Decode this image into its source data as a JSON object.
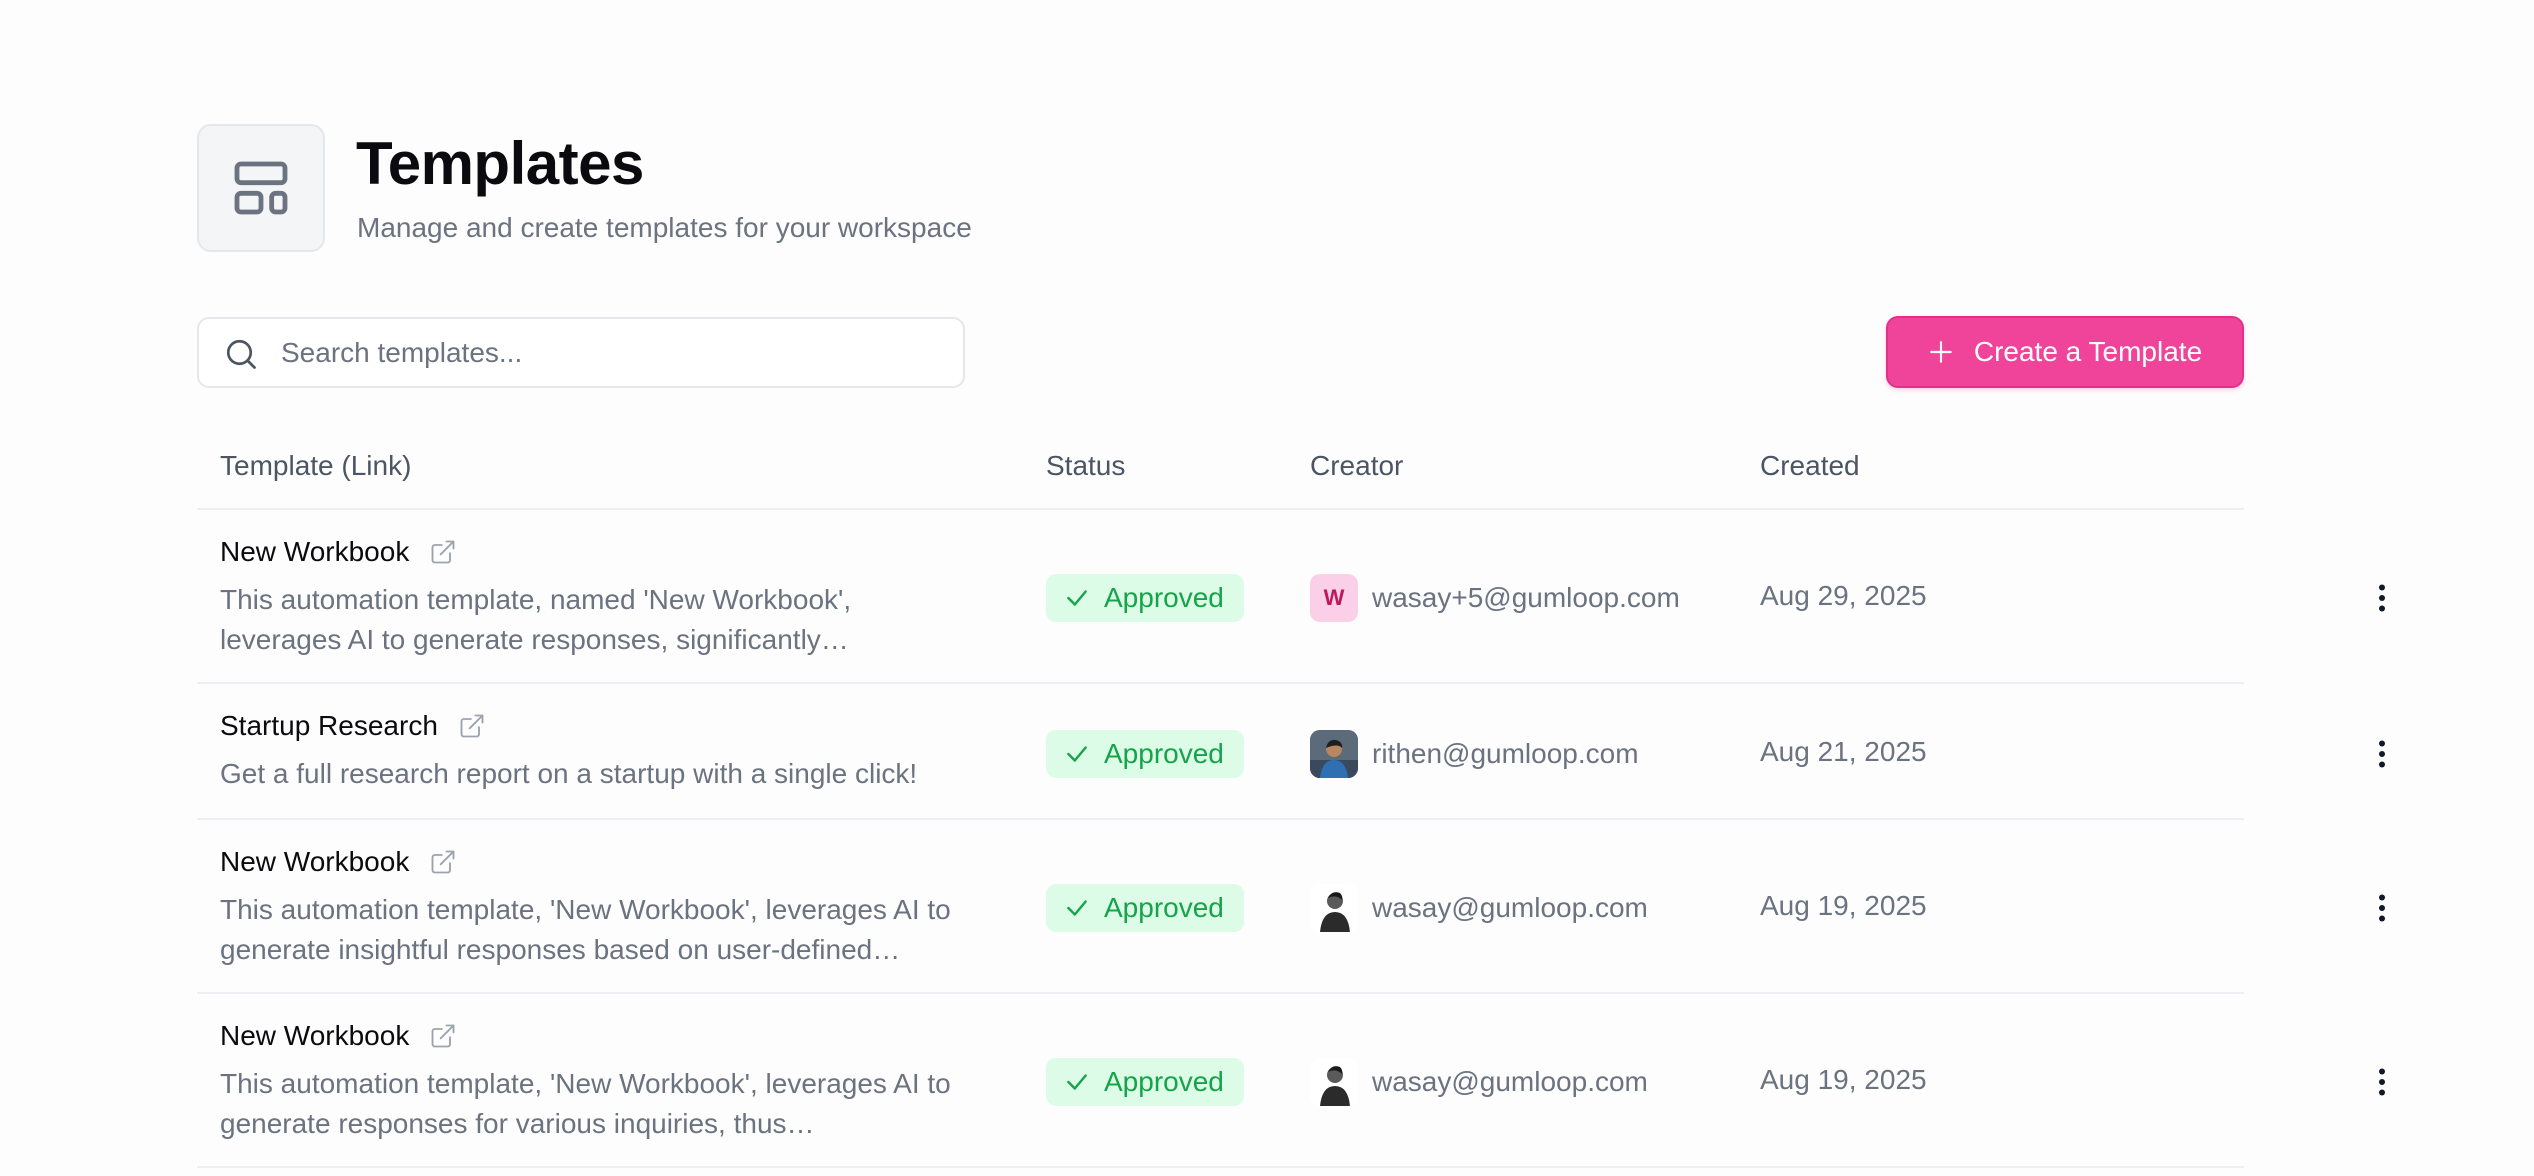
{
  "header": {
    "title": "Templates",
    "subtitle": "Manage and create templates for your workspace",
    "icon": "layout-template-icon"
  },
  "search": {
    "placeholder": "Search templates...",
    "value": ""
  },
  "actions": {
    "create_label": "Create a Template"
  },
  "colors": {
    "accent": "#f0449a",
    "approved_bg": "#dcfce7",
    "approved_text": "#16a34a"
  },
  "table": {
    "columns": [
      "Template (Link)",
      "Status",
      "Creator",
      "Created"
    ],
    "rows": [
      {
        "name": "New Workbook",
        "description": "This automation template, named 'New Workbook', leverages AI to generate responses, significantly…",
        "status": "Approved",
        "creator_initial": "W",
        "creator_email": "wasay+5@gumloop.com",
        "created": "Aug 29, 2025"
      },
      {
        "name": "Startup Research",
        "description": "Get a full research report on a startup with a single click!",
        "status": "Approved",
        "creator_email": "rithen@gumloop.com",
        "created": "Aug 21, 2025"
      },
      {
        "name": "New Workbook",
        "description": "This automation template, 'New Workbook', leverages AI to generate insightful responses based on user-defined…",
        "status": "Approved",
        "creator_email": "wasay@gumloop.com",
        "created": "Aug 19, 2025"
      },
      {
        "name": "New Workbook",
        "description": "This automation template, 'New Workbook', leverages AI to generate responses for various inquiries, thus…",
        "status": "Approved",
        "creator_email": "wasay@gumloop.com",
        "created": "Aug 19, 2025"
      }
    ]
  }
}
